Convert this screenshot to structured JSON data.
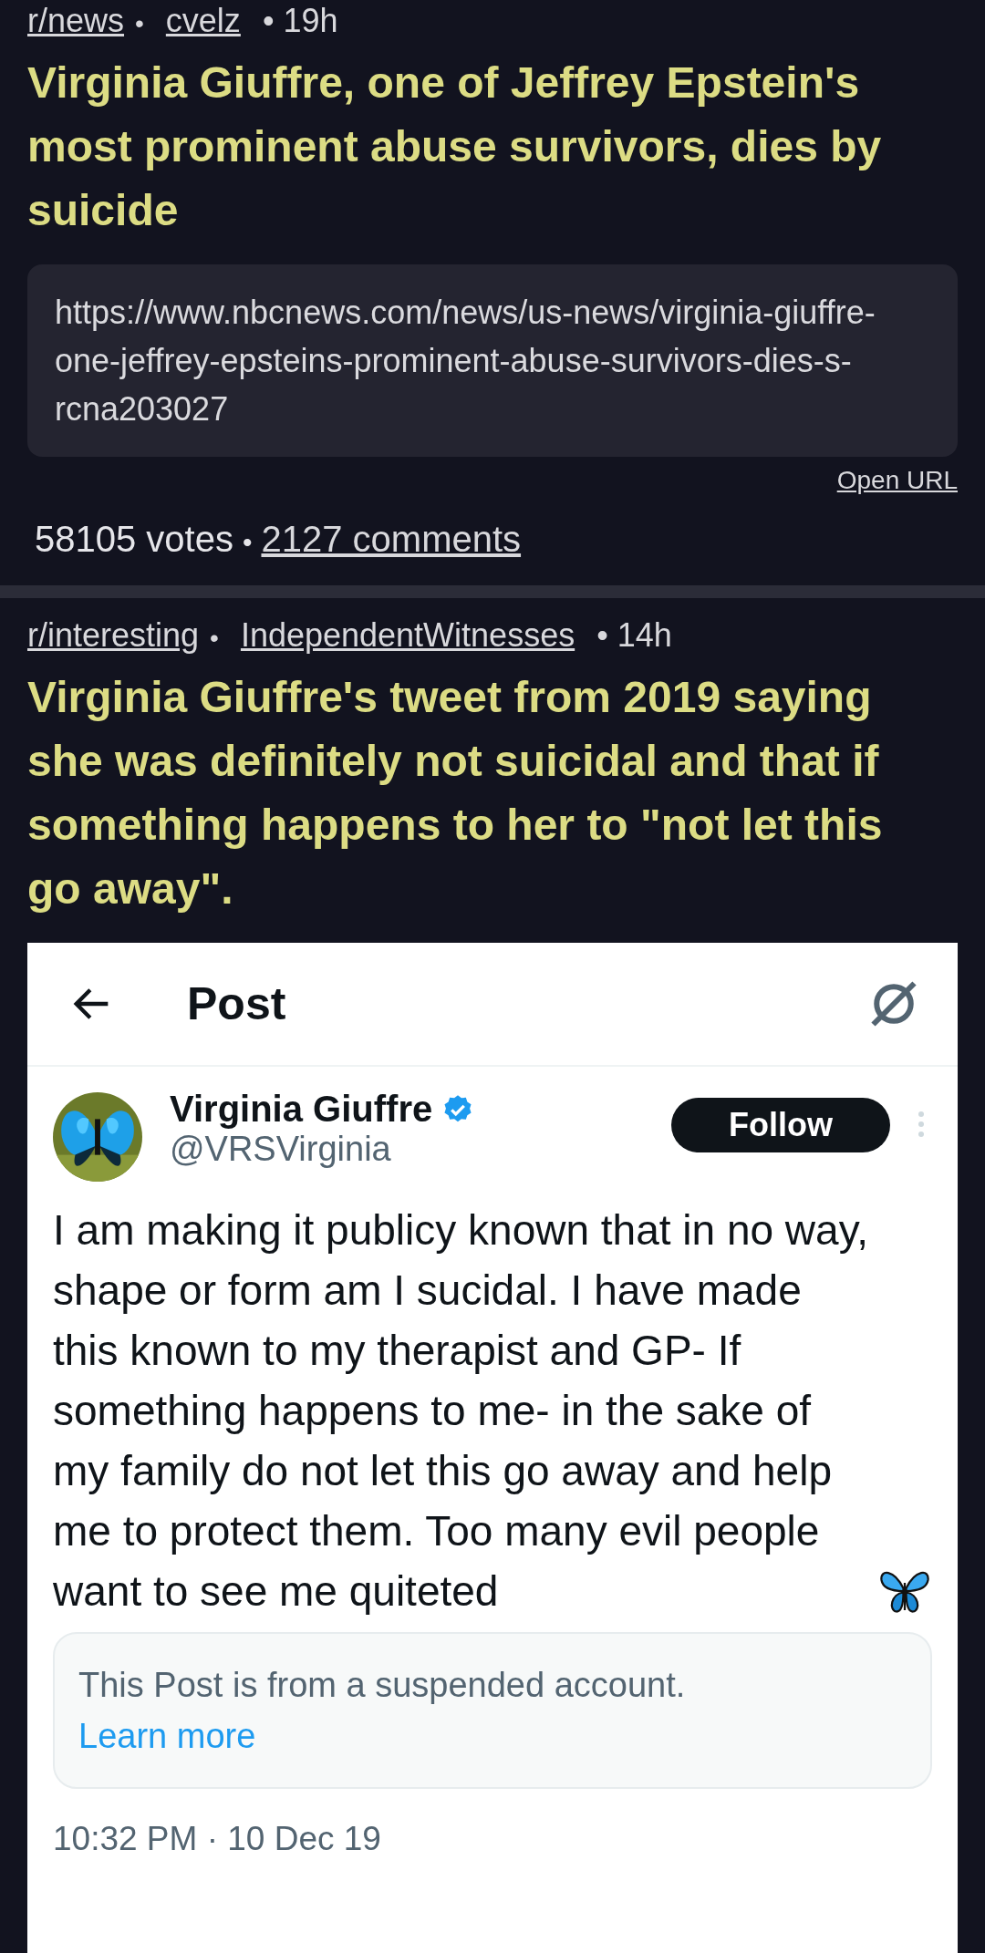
{
  "posts": [
    {
      "subreddit": "r/news",
      "separator": "•",
      "author": "cvelz",
      "age": "• 19h",
      "title": "Virginia Giuffre, one of Jeffrey Epstein's most prominent abuse survivors, dies by suicide",
      "link": {
        "url": "https://www.nbcnews.com/news/us-news/virginia-giuffre-one-jeffrey-epsteins-prominent-abuse-survivors-dies-s-rcna203027",
        "open_label": "Open URL"
      },
      "votes": "58105 votes",
      "stats_separator": "•",
      "comments": "2127 comments"
    },
    {
      "subreddit": "r/interesting",
      "separator": "•",
      "author": "IndependentWitnesses",
      "age": "• 14h",
      "title": "Virginia Giuffre's tweet from 2019 saying she was definitely not suicidal and that if something happens to her to \"not let this go away\".",
      "embed": {
        "header_title": "Post",
        "name": "Virginia Giuffre",
        "verified": true,
        "handle": "@VRSVirginia",
        "follow_label": "Follow",
        "text": "I am making it publicy known that in no way, shape or form am I sucidal. I have made this known to my therapist and GP- If something happens to me- in the sake of my family do not let this go away and help me to protect them. Too many evil people want to see me quiteted",
        "notice": "This Post is from a suspended account.",
        "notice_link": "Learn more",
        "timestamp": "10:32 PM · 10 Dec 19"
      }
    }
  ]
}
